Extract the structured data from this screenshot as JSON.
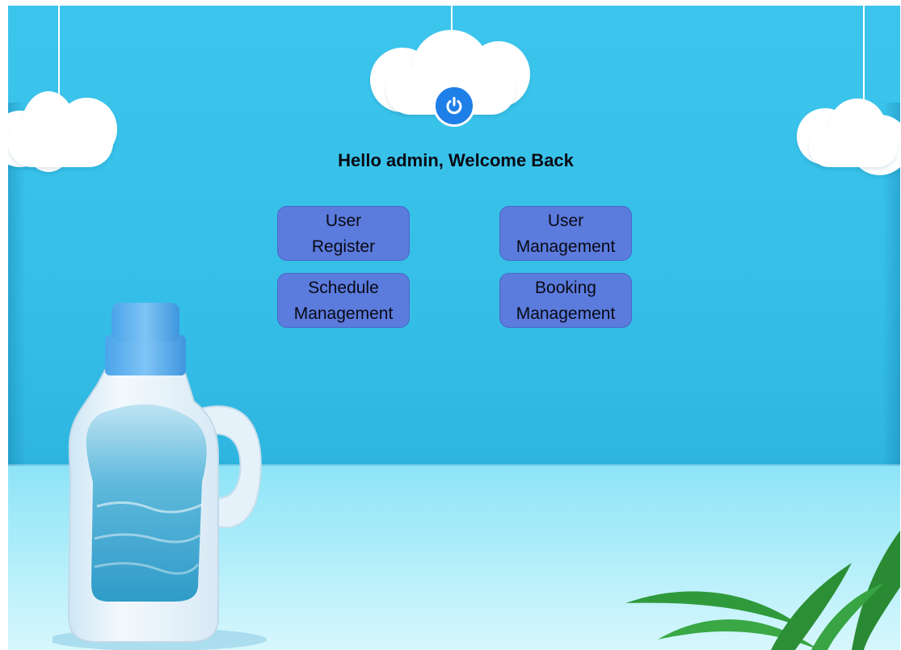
{
  "header": {
    "greeting": "Hello admin, Welcome Back",
    "logout_icon": "power-icon"
  },
  "menu": {
    "buttons": [
      {
        "line1": "User",
        "line2": "Register"
      },
      {
        "line1": "User",
        "line2": "Management"
      },
      {
        "line1": "Schedule",
        "line2": "Management"
      },
      {
        "line1": "Booking",
        "line2": "Management"
      }
    ]
  },
  "colors": {
    "background_wall": "#35bfe8",
    "button": "#5b7bdd",
    "power_button": "#1e7fe8"
  }
}
